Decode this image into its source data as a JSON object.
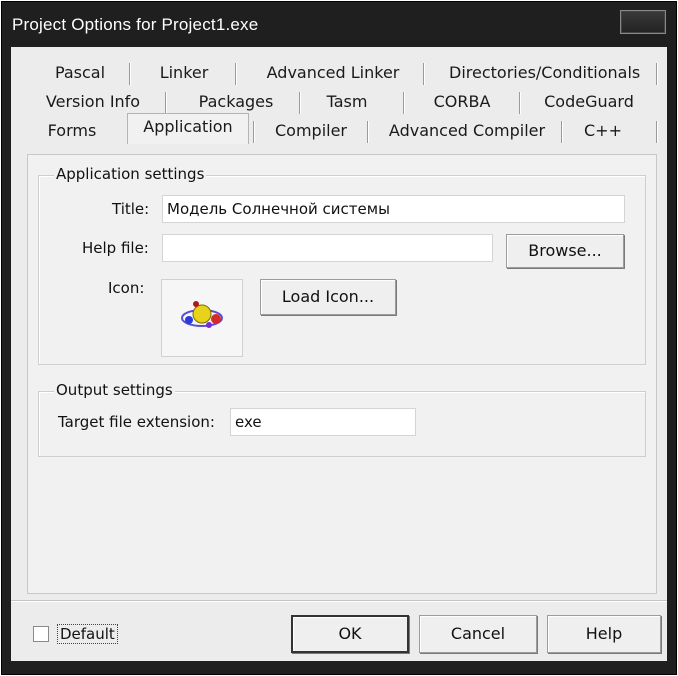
{
  "window": {
    "title": "Project Options for Project1.exe"
  },
  "tabs": {
    "row1": [
      "Pascal",
      "Linker",
      "Advanced Linker",
      "Directories/Conditionals"
    ],
    "row2": [
      "Version Info",
      "Packages",
      "Tasm",
      "CORBA",
      "CodeGuard"
    ],
    "row3": [
      "Forms",
      "Application",
      "Compiler",
      "Advanced Compiler",
      "C++"
    ],
    "active": "Application"
  },
  "application_settings": {
    "group_label": "Application settings",
    "title_label": "Title:",
    "title_value": "Модель Солнечной системы",
    "help_file_label": "Help file:",
    "help_file_value": "",
    "browse_button": "Browse...",
    "icon_label": "Icon:",
    "load_icon_button": "Load Icon..."
  },
  "output_settings": {
    "group_label": "Output settings",
    "target_ext_label": "Target file extension:",
    "target_ext_value": "exe"
  },
  "footer": {
    "default_label": "Default",
    "default_checked": false,
    "ok_button": "OK",
    "cancel_button": "Cancel",
    "help_button": "Help"
  },
  "icons": {
    "app_icon": "solar-system-icon"
  }
}
